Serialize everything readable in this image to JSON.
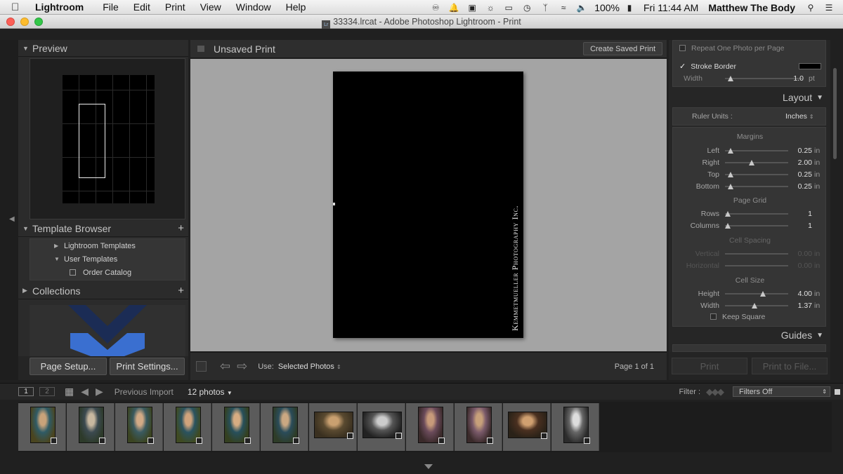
{
  "menubar": {
    "app_name": "Lightroom",
    "menus": [
      "File",
      "Edit",
      "Print",
      "View",
      "Window",
      "Help"
    ],
    "battery": "100%",
    "clock": "Fri 11:44 AM",
    "user": "Matthew The Body"
  },
  "window": {
    "title": "33334.lrcat - Adobe Photoshop Lightroom - Print"
  },
  "left_panel": {
    "preview_title": "Preview",
    "template_browser_title": "Template Browser",
    "templates": [
      {
        "label": "Lightroom Templates"
      },
      {
        "label": "User Templates"
      },
      {
        "label": "Order Catalog"
      }
    ],
    "collections_title": "Collections",
    "page_setup": "Page Setup...",
    "print_settings": "Print Settings..."
  },
  "center": {
    "title": "Unsaved Print",
    "create_saved_print": "Create Saved Print",
    "identity_plate": "Kemmetmueller Photography Inc.",
    "use_label": "Use:",
    "use_value": "Selected Photos",
    "page_indicator": "Page 1 of 1"
  },
  "right_panel": {
    "repeat_one_photo": "Repeat One Photo per Page",
    "stroke_border": "Stroke Border",
    "stroke_color": "#000000",
    "stroke_width_label": "Width",
    "stroke_width_value": "1.0",
    "stroke_width_unit": "pt",
    "layout_title": "Layout",
    "ruler_units_label": "Ruler Units :",
    "ruler_units_value": "Inches",
    "margins_title": "Margins",
    "margins": [
      {
        "label": "Left",
        "value": "0.25",
        "unit": "in",
        "fraction": 0.05
      },
      {
        "label": "Right",
        "value": "2.00",
        "unit": "in",
        "fraction": 0.4
      },
      {
        "label": "Top",
        "value": "0.25",
        "unit": "in",
        "fraction": 0.05
      },
      {
        "label": "Bottom",
        "value": "0.25",
        "unit": "in",
        "fraction": 0.05
      }
    ],
    "page_grid_title": "Page Grid",
    "page_grid": [
      {
        "label": "Rows",
        "value": "1",
        "fraction": 0.0
      },
      {
        "label": "Columns",
        "value": "1",
        "fraction": 0.0
      }
    ],
    "cell_spacing_title": "Cell Spacing",
    "cell_spacing": [
      {
        "label": "Vertical",
        "value": "0.00",
        "unit": "in"
      },
      {
        "label": "Horizontal",
        "value": "0.00",
        "unit": "in"
      }
    ],
    "cell_size_title": "Cell Size",
    "cell_size": [
      {
        "label": "Height",
        "value": "4.00",
        "unit": "in",
        "fraction": 0.58
      },
      {
        "label": "Width",
        "value": "1.37",
        "unit": "in",
        "fraction": 0.44
      }
    ],
    "keep_square": "Keep Square",
    "guides_title": "Guides",
    "print_button": "Print",
    "print_to_file_button": "Print to File..."
  },
  "filmstrip": {
    "screen1": "1",
    "screen2": "2",
    "source": "Previous Import",
    "count": "12 photos",
    "filter_label": "Filter :",
    "filter_value": "Filters Off",
    "photo_count": 12
  }
}
